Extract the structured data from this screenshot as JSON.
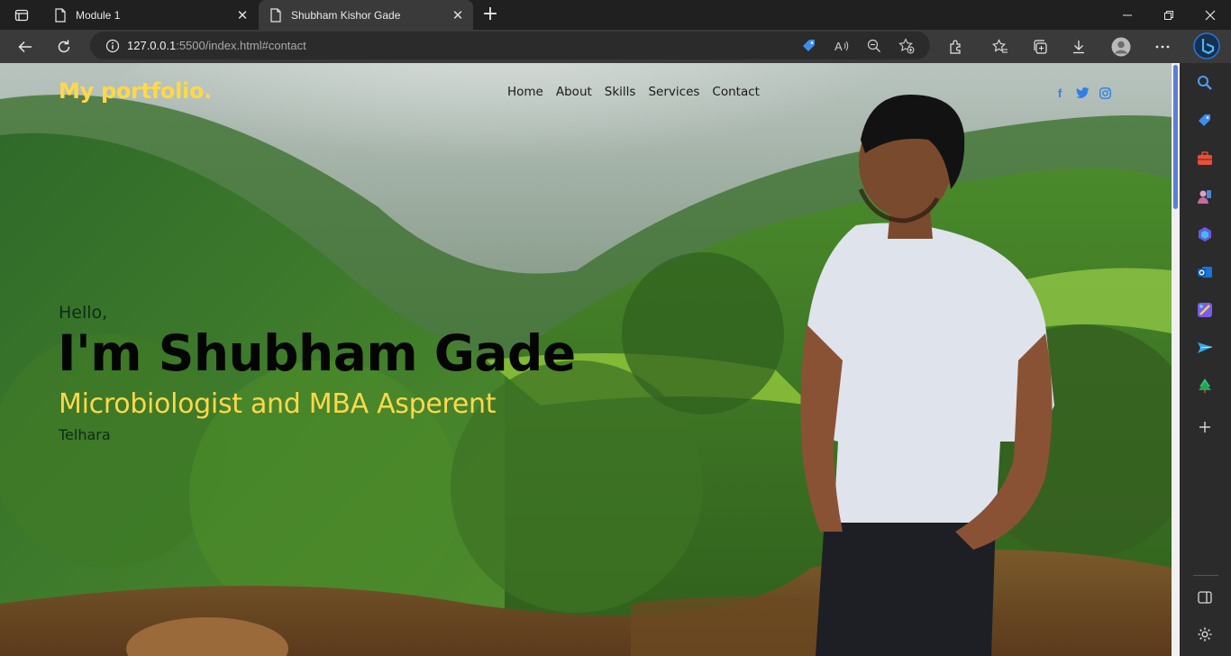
{
  "browser": {
    "tabs": [
      {
        "title": "Module 1",
        "active": false
      },
      {
        "title": "Shubham Kishor Gade",
        "active": true
      }
    ],
    "address": {
      "host": "127.0.0.1",
      "path": ":5500/index.html#contact"
    },
    "window_controls": [
      "minimize",
      "restore",
      "close"
    ],
    "toolbar_icons": [
      "back-icon",
      "refresh-icon",
      "coupon-icon",
      "read-aloud-icon",
      "zoom-out-icon",
      "add-favorite-icon",
      "extensions-icon",
      "favorites-icon",
      "collections-icon",
      "downloads-icon",
      "profile-icon",
      "more-icon",
      "bing-copilot-icon"
    ],
    "sidebar_icons": [
      "search-icon",
      "shopping-icon",
      "tools-icon",
      "games-icon",
      "copilot-icon",
      "outlook-icon",
      "designer-icon",
      "send-icon",
      "tree-icon",
      "add-icon",
      "sidebar-toggle-icon",
      "settings-icon"
    ]
  },
  "site": {
    "logo": "My portfolio.",
    "nav": [
      "Home",
      "About",
      "Skills",
      "Services",
      "Contact"
    ],
    "social": [
      "facebook-icon",
      "twitter-icon",
      "instagram-icon"
    ],
    "hero": {
      "greeting": "Hello,",
      "name": "I'm Shubham Gade",
      "role": "Microbiologist and MBA Asperent",
      "location": "Telhara"
    },
    "colors": {
      "accent": "#ffd84a",
      "social": "#2f7fe8",
      "nav_text": "#1a1a1a"
    }
  }
}
